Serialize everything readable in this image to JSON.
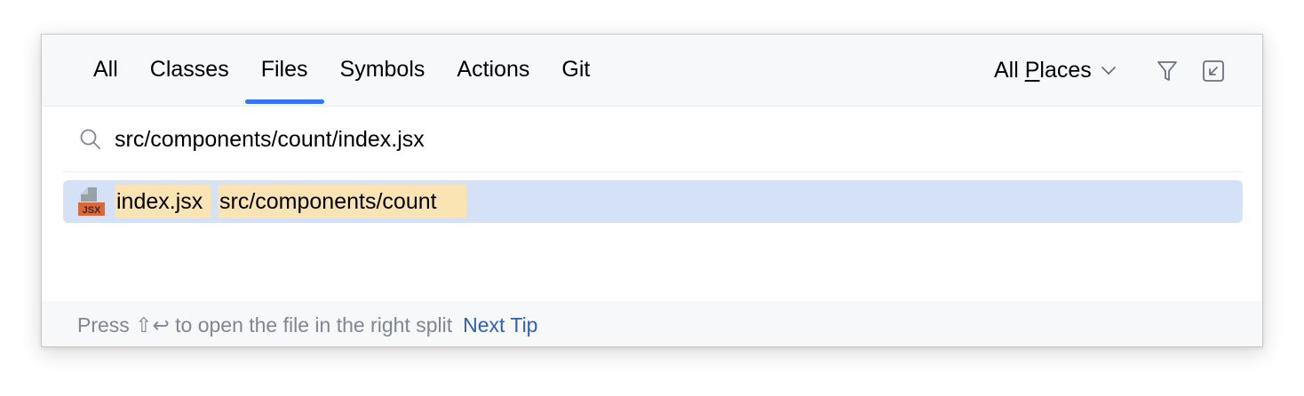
{
  "tabs": [
    {
      "label": "All",
      "active": false
    },
    {
      "label": "Classes",
      "active": false
    },
    {
      "label": "Files",
      "active": true
    },
    {
      "label": "Symbols",
      "active": false
    },
    {
      "label": "Actions",
      "active": false
    },
    {
      "label": "Git",
      "active": false
    }
  ],
  "scope": {
    "label_prefix": "All ",
    "label_mnemonic": "P",
    "label_suffix": "laces"
  },
  "header_icons": [
    "filter-icon",
    "collapse-to-corner-icon"
  ],
  "search": {
    "value": "src/components/count/index.jsx",
    "icon": "search-icon"
  },
  "results": [
    {
      "file_name": "index.jsx",
      "location": "src/components/count",
      "icon_label": "JSX",
      "selected": true
    }
  ],
  "footer": {
    "tip_prefix": "Press ",
    "tip_keys": "⇧↩",
    "tip_suffix": " to open the file in the right split",
    "next_tip": "Next Tip"
  },
  "colors": {
    "accent": "#3574f0",
    "selection": "#d5e1f7",
    "match_highlight": "#fbe4b3",
    "link": "#2f5fb8",
    "muted_text": "#818594",
    "jsx_badge": "#d9693a"
  }
}
